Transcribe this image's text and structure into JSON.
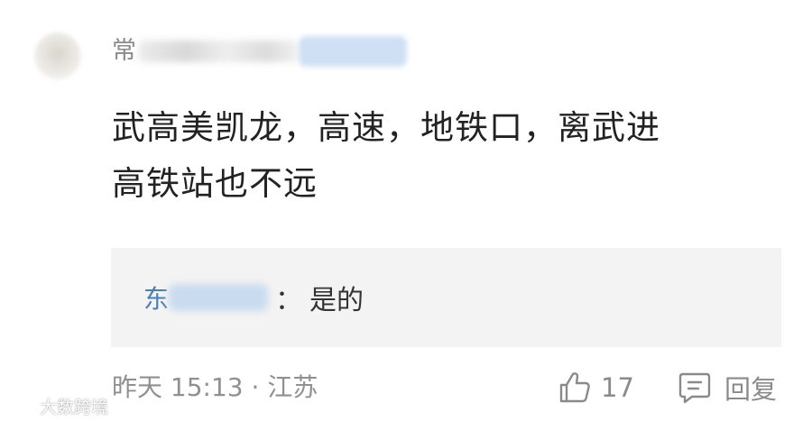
{
  "comment": {
    "username_visible": "常",
    "text_line1": "武高美凯龙，高速，地铁口，离武进",
    "text_line2": "高铁站也不远"
  },
  "reply": {
    "username_visible": "东",
    "separator": "：",
    "text": "是的"
  },
  "meta": {
    "time": "昨天 15:13",
    "dot": "·",
    "location": "江苏"
  },
  "actions": {
    "like_count": "17",
    "reply_label": "回复"
  },
  "watermark": {
    "text": "大数跨境"
  },
  "colors": {
    "reply_username": "#4a7eb8",
    "reply_bg": "#f3f3f3",
    "secondary_text": "#909090"
  }
}
